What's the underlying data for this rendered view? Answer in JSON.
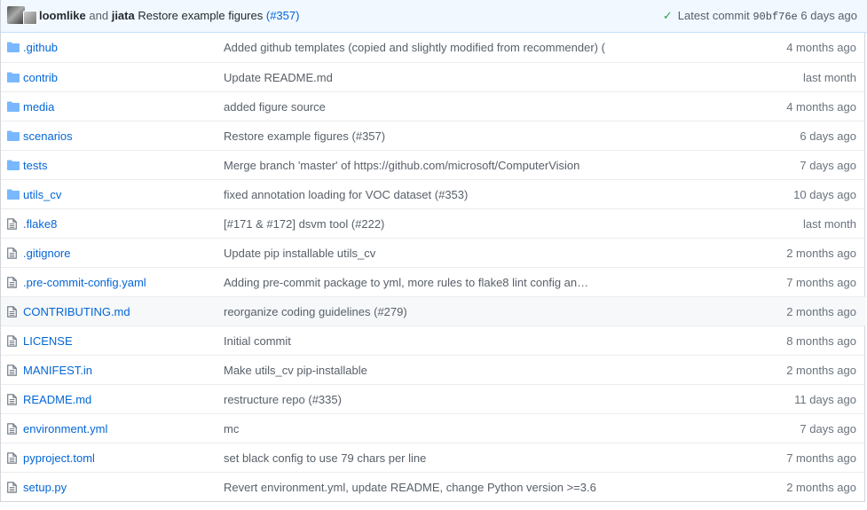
{
  "latest_commit": {
    "author1": "loomlike",
    "and_text": "and",
    "author2": "jiata",
    "message": "Restore example figures",
    "pr_link": "(#357)",
    "label": "Latest commit",
    "sha": "90bf76e",
    "age": "6 days ago"
  },
  "files": [
    {
      "type": "dir",
      "name": ".github",
      "message": "Added github templates (copied and slightly modified from recommender) (",
      "age": "4 months ago"
    },
    {
      "type": "dir",
      "name": "contrib",
      "message": "Update README.md",
      "age": "last month"
    },
    {
      "type": "dir",
      "name": "media",
      "message": "added figure source",
      "age": "4 months ago"
    },
    {
      "type": "dir",
      "name": "scenarios",
      "message": "Restore example figures (#357)",
      "age": "6 days ago"
    },
    {
      "type": "dir",
      "name": "tests",
      "message": "Merge branch 'master' of https://github.com/microsoft/ComputerVision",
      "age": "7 days ago"
    },
    {
      "type": "dir",
      "name": "utils_cv",
      "message": "fixed annotation loading for VOC dataset (#353)",
      "age": "10 days ago"
    },
    {
      "type": "file",
      "name": ".flake8",
      "message": "[#171 & #172] dsvm tool (#222)",
      "age": "last month"
    },
    {
      "type": "file",
      "name": ".gitignore",
      "message": "Update pip installable utils_cv",
      "age": "2 months ago"
    },
    {
      "type": "file",
      "name": ".pre-commit-config.yaml",
      "message": "Adding pre-commit package to yml, more rules to flake8 lint config an…",
      "age": "7 months ago"
    },
    {
      "type": "file",
      "name": "CONTRIBUTING.md",
      "message": "reorganize coding guidelines (#279)",
      "age": "2 months ago"
    },
    {
      "type": "file",
      "name": "LICENSE",
      "message": "Initial commit",
      "age": "8 months ago"
    },
    {
      "type": "file",
      "name": "MANIFEST.in",
      "message": "Make utils_cv pip-installable",
      "age": "2 months ago"
    },
    {
      "type": "file",
      "name": "README.md",
      "message": "restructure repo (#335)",
      "age": "11 days ago"
    },
    {
      "type": "file",
      "name": "environment.yml",
      "message": "mc",
      "age": "7 days ago"
    },
    {
      "type": "file",
      "name": "pyproject.toml",
      "message": "set black config to use 79 chars per line",
      "age": "7 months ago"
    },
    {
      "type": "file",
      "name": "setup.py",
      "message": "Revert environment.yml, update README, change Python version >=3.6",
      "age": "2 months ago"
    }
  ],
  "icons": {
    "dir": "folder-icon",
    "file": "file-icon"
  },
  "colors": {
    "link": "#0366d6",
    "check": "#28a745",
    "folder": "#79b8ff",
    "file_icon": "#6a737d",
    "header_bg": "#f1f8ff"
  }
}
